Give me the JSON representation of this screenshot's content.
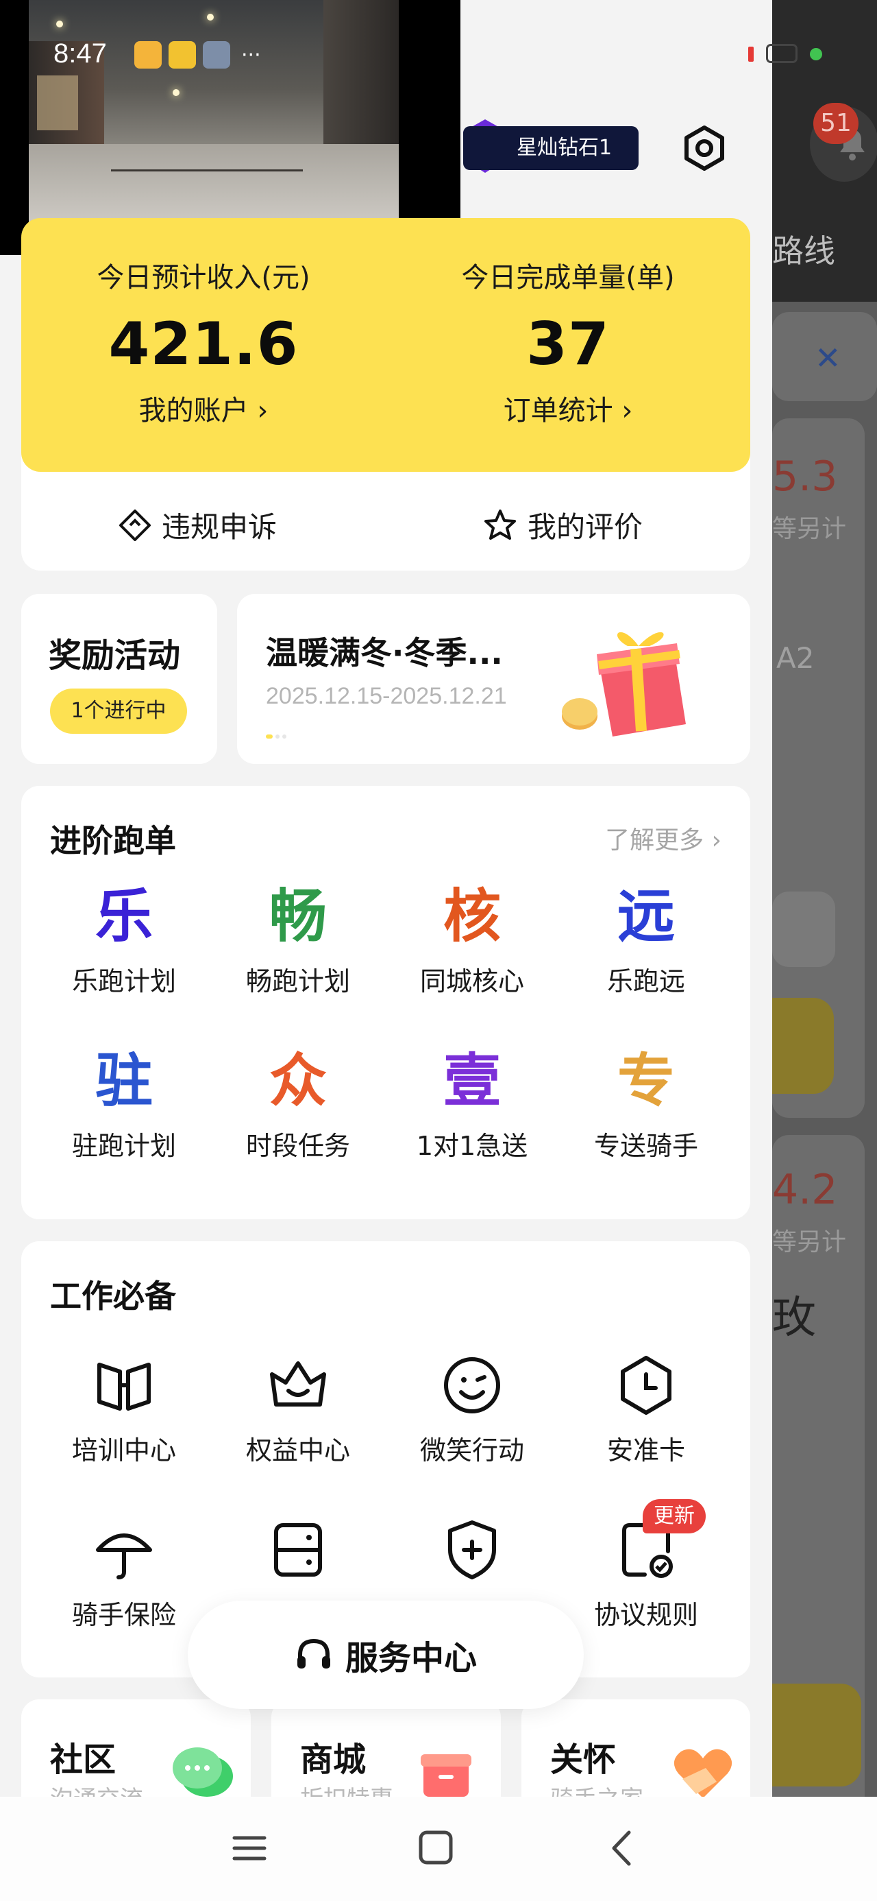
{
  "status_bar": {
    "time": "8:47",
    "more": "···"
  },
  "background_app": {
    "notification_count": "51",
    "route_label": "路线",
    "close": "✕",
    "value_1": "5.3",
    "sub_1": "等另计",
    "code": "A2",
    "value_2": "4.2",
    "sub_2": "等另计",
    "char": "玫"
  },
  "header": {
    "rank_label": "星灿钻石1"
  },
  "earnings": {
    "income_label": "今日预计收入(元)",
    "income_value": "421.6",
    "account_link": "我的账户",
    "orders_label": "今日完成单量(单)",
    "orders_value": "37",
    "orders_link": "订单统计",
    "chevron": "›"
  },
  "quick_actions": [
    {
      "label": "违规申诉",
      "icon": "appeal-icon"
    },
    {
      "label": "我的评价",
      "icon": "star-icon"
    }
  ],
  "reward": {
    "title": "奖励活动",
    "pill": "1个进行中"
  },
  "promo": {
    "title": "温暖满冬·冬季...",
    "date": "2025.12.15-2025.12.21"
  },
  "advanced": {
    "title": "进阶跑单",
    "more": "了解更多 ›",
    "items": [
      {
        "glyph": "乐",
        "label": "乐跑计划",
        "color": "#3a22d6"
      },
      {
        "glyph": "畅",
        "label": "畅跑计划",
        "color": "#2f9a4a"
      },
      {
        "glyph": "核",
        "label": "同城核心",
        "color": "#e2571f"
      },
      {
        "glyph": "远",
        "label": "乐跑远",
        "color": "#2a3fd6"
      },
      {
        "glyph": "驻",
        "label": "驻跑计划",
        "color": "#2a55d0"
      },
      {
        "glyph": "众",
        "label": "时段任务",
        "color": "#e85a2a"
      },
      {
        "glyph": "壹",
        "label": "1对1急送",
        "color": "#7b2fd8"
      },
      {
        "glyph": "专",
        "label": "专送骑手",
        "color": "#e3a23a"
      }
    ]
  },
  "work": {
    "title": "工作必备",
    "items": [
      {
        "label": "培训中心",
        "icon": "book-icon"
      },
      {
        "label": "权益中心",
        "icon": "crown-icon"
      },
      {
        "label": "微笑行动",
        "icon": "smile-icon"
      },
      {
        "label": "安准卡",
        "icon": "clock-badge-icon"
      },
      {
        "label": "骑手保险",
        "icon": "umbrella-icon"
      },
      {
        "label": "",
        "icon": "card-icon"
      },
      {
        "label": "",
        "icon": "shield-plus-icon"
      },
      {
        "label": "协议规则",
        "icon": "document-check-icon"
      }
    ],
    "new_badge": "更新"
  },
  "service_center": {
    "label": "服务中心"
  },
  "bottom_cards": [
    {
      "title": "社区",
      "sub": "沟通交流"
    },
    {
      "title": "商城",
      "sub": "折扣特惠"
    },
    {
      "title": "关怀",
      "sub": "骑手之家"
    }
  ],
  "colors": {
    "accent_yellow": "#fde152",
    "rank_bg": "#10173a",
    "badge_red": "#e8403c"
  }
}
